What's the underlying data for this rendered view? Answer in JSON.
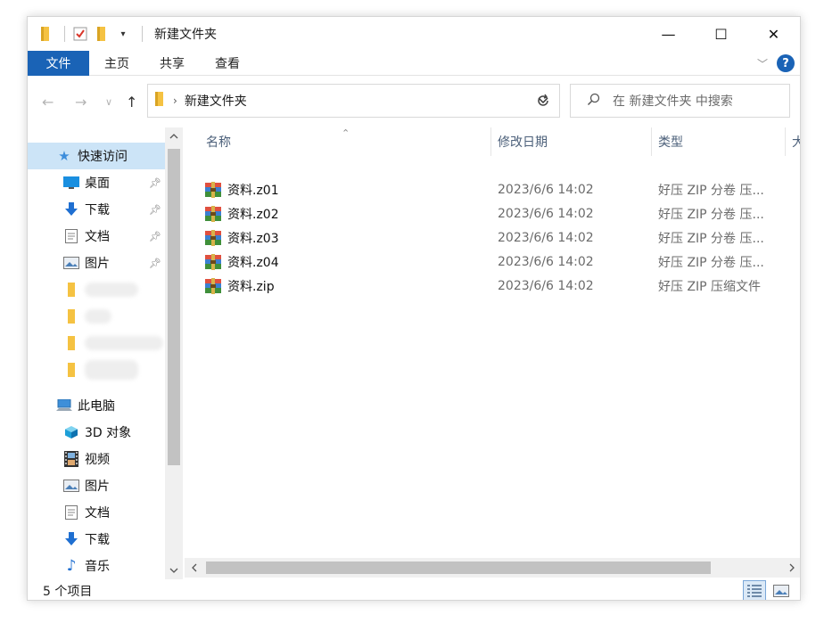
{
  "window": {
    "title": "新建文件夹",
    "controls": {
      "minimize": "—",
      "maximize": "☐",
      "close": "✕"
    }
  },
  "ribbon": {
    "tabs": [
      "文件",
      "主页",
      "共享",
      "查看"
    ],
    "help": "?"
  },
  "address": {
    "path": "新建文件夹",
    "search_placeholder": "在 新建文件夹 中搜索"
  },
  "sidebar": {
    "quick_access": "快速访问",
    "pinned": [
      "桌面",
      "下载",
      "文档",
      "图片"
    ],
    "this_pc": "此电脑",
    "pc_items": [
      "3D 对象",
      "视频",
      "图片",
      "文档",
      "下载",
      "音乐"
    ]
  },
  "columns": {
    "name": "名称",
    "date": "修改日期",
    "type": "类型",
    "size_partial": "大"
  },
  "files": [
    {
      "name": "资料.z01",
      "date": "2023/6/6 14:02",
      "type": "好压 ZIP 分卷 压..."
    },
    {
      "name": "资料.z02",
      "date": "2023/6/6 14:02",
      "type": "好压 ZIP 分卷 压..."
    },
    {
      "name": "资料.z03",
      "date": "2023/6/6 14:02",
      "type": "好压 ZIP 分卷 压..."
    },
    {
      "name": "资料.z04",
      "date": "2023/6/6 14:02",
      "type": "好压 ZIP 分卷 压..."
    },
    {
      "name": "资料.zip",
      "date": "2023/6/6 14:02",
      "type": "好压 ZIP 压缩文件"
    }
  ],
  "status": {
    "item_count": "5 个项目"
  },
  "colors": {
    "accent": "#1a63b6",
    "selected": "#cce4f7",
    "folder": "#f5c242"
  }
}
